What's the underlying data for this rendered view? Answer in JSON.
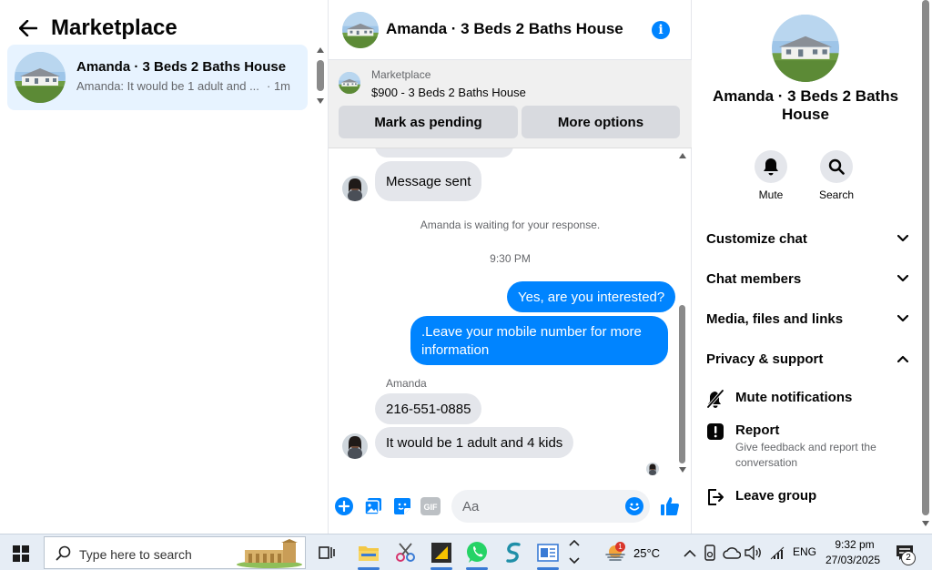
{
  "left": {
    "title": "Marketplace",
    "conversation": {
      "name": "Amanda · 3 Beds 2 Baths House",
      "preview": "Amanda: It would be 1 adult and ...",
      "time": "· 1m"
    }
  },
  "chat_header": {
    "title": "Amanda · 3 Beds 2 Baths House"
  },
  "listing": {
    "kicker": "Marketplace",
    "price_title": "$900 - 3 Beds 2 Baths House",
    "mark_pending": "Mark as pending",
    "more_options": "More options"
  },
  "messages": {
    "msg_sent": "Message sent",
    "waiting": "Amanda is waiting for your response.",
    "time": "9:30 PM",
    "out1": "Yes, are you interested?",
    "out2_line1": ".Leave your mobile number for more",
    "out2_line2": "information",
    "sender": "Amanda",
    "in_phone": "216-551-0885",
    "in_last": "It would be 1 adult and 4 kids"
  },
  "composer": {
    "placeholder": "Aa"
  },
  "right": {
    "name_line1": "Amanda · 3 Beds 2 Baths",
    "name_line2": "House",
    "mute": "Mute",
    "search": "Search",
    "sections": [
      "Customize chat",
      "Chat members",
      "Media, files and links",
      "Privacy & support"
    ],
    "mute_notifications": "Mute notifications",
    "report": "Report",
    "report_sub_line1": "Give feedback and report the",
    "report_sub_line2": "conversation",
    "leave_group": "Leave group"
  },
  "taskbar": {
    "search_placeholder": "Type here to search",
    "weather_badge": "1",
    "temperature": "25°C",
    "language": "ENG",
    "time": "9:32 pm",
    "date": "27/03/2025",
    "notifications": "2"
  },
  "colors": {
    "accent": "#0084ff",
    "selected_bg": "#e7f3ff",
    "incoming_bubble": "#e4e6eb"
  }
}
